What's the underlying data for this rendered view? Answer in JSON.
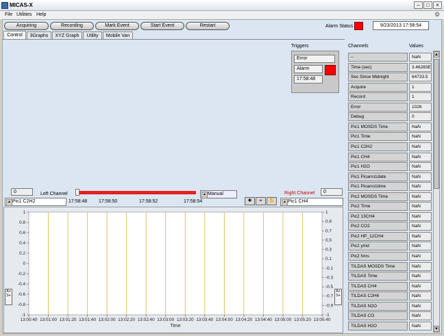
{
  "window": {
    "title": "MICAS-X"
  },
  "menu": [
    {
      "label": "File"
    },
    {
      "label": "Utilities"
    },
    {
      "label": "Help"
    }
  ],
  "toolbar": {
    "buttons": [
      {
        "label": "Acquiring"
      },
      {
        "label": "Recording"
      },
      {
        "label": "Mark Event"
      },
      {
        "label": "Start Event"
      },
      {
        "label": "Restart"
      }
    ],
    "alarm_label": "Alarm Status",
    "alarm_color": "#ff0000",
    "datetime": "9/23/2013 17:58:54"
  },
  "tabs": [
    {
      "label": "Control",
      "active": true
    },
    {
      "label": "3Graphs"
    },
    {
      "label": "XYZ Graph"
    },
    {
      "label": "Utility"
    },
    {
      "label": "Mobile Van"
    }
  ],
  "triggers": {
    "title": "Triggers",
    "state": "Error",
    "level": "Alarm",
    "time": "17:58:48",
    "indicator_color": "#ff0000"
  },
  "channels": {
    "header_name": "Channels",
    "header_value": "Values",
    "rows": [
      {
        "name": "--",
        "value": "NaN"
      },
      {
        "name": "Time (sec)",
        "value": "3.46283E"
      },
      {
        "name": "Sec Since Midnight",
        "value": "64733.5"
      },
      {
        "name": "Acquire",
        "value": "1"
      },
      {
        "name": "Record",
        "value": "1"
      },
      {
        "name": "Error",
        "value": "1026"
      },
      {
        "name": "Debug",
        "value": "0"
      },
      {
        "name": "Pic1 MOSDS Time",
        "value": "NaN"
      },
      {
        "name": "Pic1 Time",
        "value": "NaN"
      },
      {
        "name": "Pic1 C2H2",
        "value": "NaN"
      },
      {
        "name": "Pic1 CH4",
        "value": "NaN"
      },
      {
        "name": "Pic1 H2O",
        "value": "NaN"
      },
      {
        "name": "Pic1 Picarro1date",
        "value": "NaN"
      },
      {
        "name": "Pic1 Picarro1time",
        "value": "NaN"
      },
      {
        "name": "Pic2 MOSDS Time",
        "value": "NaN"
      },
      {
        "name": "Pic2 Time",
        "value": "NaN"
      },
      {
        "name": "Pic2 13CH4",
        "value": "NaN"
      },
      {
        "name": "Pic2 CO2",
        "value": "NaN"
      },
      {
        "name": "Pic2 HP_12CH4",
        "value": "NaN"
      },
      {
        "name": "Pic2 ymd",
        "value": "NaN"
      },
      {
        "name": "Pic2 hms",
        "value": "NaN"
      },
      {
        "name": "TILDAS MOSDS Time",
        "value": "NaN"
      },
      {
        "name": "TILDAS Time",
        "value": "NaN"
      },
      {
        "name": "TILDAS CH4",
        "value": "NaN"
      },
      {
        "name": "TILDAS C2H6",
        "value": "NaN"
      },
      {
        "name": "TILDAS N2O",
        "value": "NaN"
      },
      {
        "name": "TILDAS CO",
        "value": "NaN"
      },
      {
        "name": "TILDAS H2O",
        "value": "NaN"
      }
    ]
  },
  "controls": {
    "left_value": "0",
    "left_label": "Left Channel",
    "left_channel": "Pic1 C2H2",
    "right_value": "0",
    "right_label": "Right Channel",
    "right_label_color": "#cc0000",
    "right_channel": "Pic1 CH4",
    "mode": "Manual",
    "slider_ticks": [
      "17:58:48",
      "17:58:50",
      "17:58:52",
      "17:58:54"
    ],
    "slider_color": "#e52020",
    "autoscale_label": "A+ S+"
  },
  "chart_data": {
    "type": "line",
    "title": "",
    "xlabel": "Time",
    "ylabel": "",
    "x_ticks": [
      "13:00:40",
      "13:01:00",
      "13:01:20",
      "13:01:40",
      "13:02:00",
      "13:02:20",
      "13:02:40",
      "13:03:00",
      "13:03:20",
      "13:03:40",
      "13:04:00",
      "13:04:20",
      "13:04:40",
      "13:05:00",
      "13:05:20",
      "13:05:40"
    ],
    "left_axis": {
      "ylim": [
        -1,
        1
      ],
      "ticks": [
        "1",
        "0.8",
        "0.6",
        "0.4",
        "0.2",
        "0",
        "-0.2",
        "-0.4",
        "-0.6",
        "-0.8",
        "-1"
      ]
    },
    "right_axis": {
      "ylim": [
        -1,
        1
      ],
      "ticks": [
        "1",
        "0.9",
        "0.7",
        "0.5",
        "0.3",
        "0.1",
        "-0.1",
        "-0.3",
        "-0.5",
        "-0.7",
        "-0.9",
        "-1"
      ]
    },
    "series": [],
    "grid": true,
    "grid_color": "#e0b040",
    "plot_bg": "#ffffff"
  }
}
